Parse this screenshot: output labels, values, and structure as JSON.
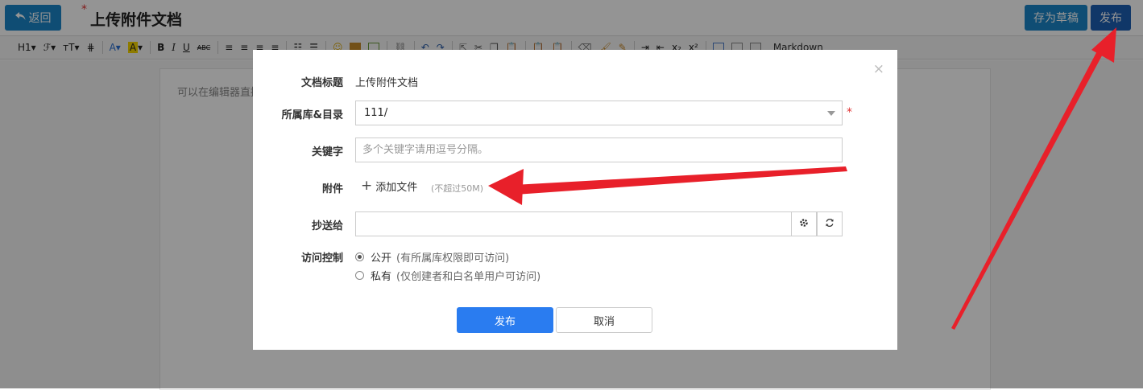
{
  "header": {
    "back_label": "返回",
    "required_mark": "*",
    "doc_title": "上传附件文档",
    "draft_label": "存为草稿",
    "publish_label": "发布"
  },
  "toolbar": {
    "heading": "H1",
    "font": "ℱ",
    "font_size": "ᴛT",
    "bold": "B",
    "italic": "I",
    "underline": "U",
    "strike": "ABC",
    "markdown": "Markdown"
  },
  "editor": {
    "hint": "可以在编辑器直接"
  },
  "modal": {
    "close": "×",
    "title_label": "文档标题",
    "title_value": "上传附件文档",
    "library_label": "所属库&目录",
    "library_value": "111/",
    "required_mark": "*",
    "keywords_label": "关键字",
    "keywords_placeholder": "多个关键字请用逗号分隔。",
    "attachment_label": "附件",
    "add_file_label": "添加文件",
    "size_hint": "(不超过50M)",
    "cc_label": "抄送给",
    "access_label": "访问控制",
    "access_options": [
      {
        "label": "公开",
        "note": "(有所属库权限即可访问)",
        "checked": true
      },
      {
        "label": "私有",
        "note": "(仅创建者和白名单用户可访问)",
        "checked": false
      }
    ],
    "submit_label": "发布",
    "cancel_label": "取消"
  },
  "colors": {
    "primary": "#2a7cf0",
    "header_button": "#1a86c9",
    "publish_top": "#1d5fb3",
    "annotation_arrow": "#e8202a"
  }
}
